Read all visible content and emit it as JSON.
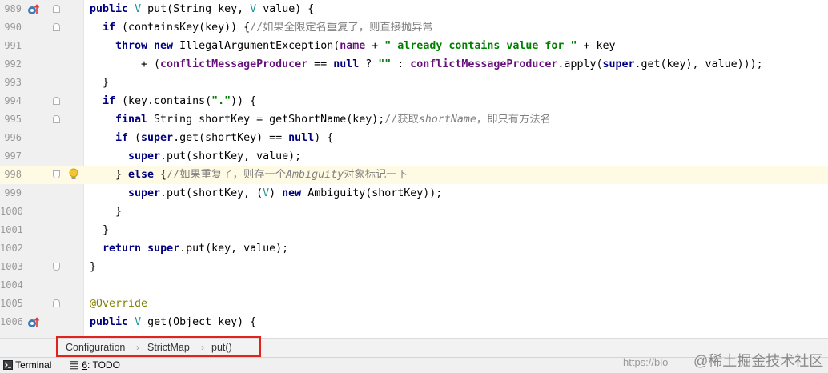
{
  "editor": {
    "lines": [
      {
        "num": "989",
        "code": "public V put(String key, V value) {"
      },
      {
        "num": "990",
        "code": "if (containsKey(key)) {//如果全限定名重复了，则直接抛异常"
      },
      {
        "num": "991",
        "code": "throw new IllegalArgumentException(name + \" already contains value for \" + key"
      },
      {
        "num": "992",
        "code": "+ (conflictMessageProducer == null ? \"\" : conflictMessageProducer.apply(super.get(key), value)));"
      },
      {
        "num": "993",
        "code": "}"
      },
      {
        "num": "994",
        "code": "if (key.contains(\".\")) {"
      },
      {
        "num": "995",
        "code": "final String shortKey = getShortName(key);//获取shortName，即只有方法名"
      },
      {
        "num": "996",
        "code": "if (super.get(shortKey) == null) {"
      },
      {
        "num": "997",
        "code": "super.put(shortKey, value);"
      },
      {
        "num": "998",
        "code": "} else {//如果重复了，则存一个Ambiguity对象标记一下"
      },
      {
        "num": "999",
        "code": "super.put(shortKey, (V) new Ambiguity(shortKey));"
      },
      {
        "num": "1000",
        "code": "}"
      },
      {
        "num": "1001",
        "code": "}"
      },
      {
        "num": "1002",
        "code": "return super.put(key, value);"
      },
      {
        "num": "1003",
        "code": "}"
      },
      {
        "num": "1004",
        "code": ""
      },
      {
        "num": "1005",
        "code": "@Override"
      },
      {
        "num": "1006",
        "code": "public V get(Object key) {"
      }
    ]
  },
  "breadcrumb": {
    "items": [
      "Configuration",
      "StrictMap",
      "put()"
    ]
  },
  "toolbar": {
    "terminal_label": "Terminal",
    "todo_number": "6",
    "todo_label": ": TODO"
  },
  "watermark": {
    "url_text": "https://blo",
    "brand_text": "@稀土掘金技术社区"
  },
  "colors": {
    "keyword": "#000080",
    "string": "#008000",
    "comment": "#808080",
    "type_param": "#20999d",
    "field": "#660e7a",
    "annotation": "#808000",
    "highlight_box": "#e0231b"
  },
  "icons": [
    "override-gutter-icon",
    "fold-marker-icon",
    "intention-bulb-icon",
    "chevron-right-icon",
    "terminal-icon",
    "todo-icon"
  ]
}
